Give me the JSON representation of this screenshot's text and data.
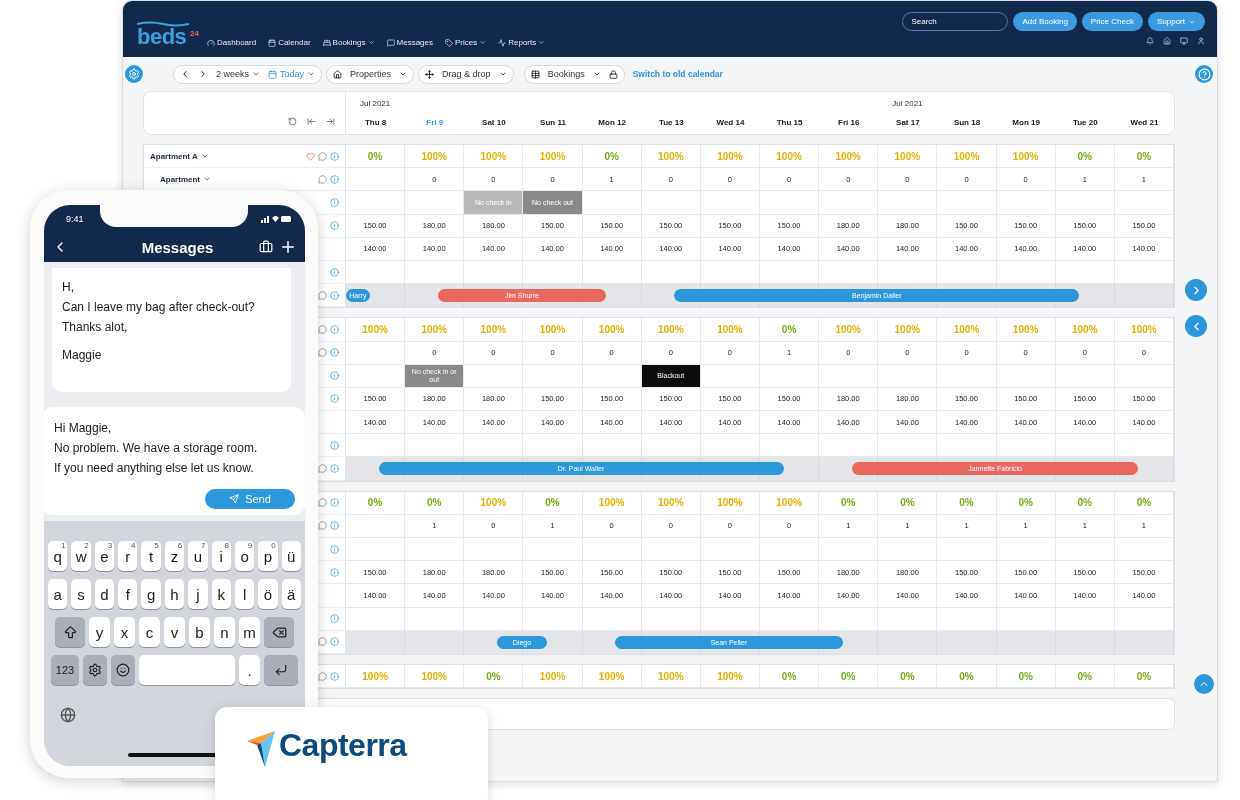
{
  "app": {
    "logo": {
      "text": "beds",
      "badge": "24"
    },
    "nav": [
      {
        "label": "Dashboard",
        "dropdown": false
      },
      {
        "label": "Calendar",
        "dropdown": false
      },
      {
        "label": "Bookings",
        "dropdown": true
      },
      {
        "label": "Messages",
        "dropdown": false
      },
      {
        "label": "Prices",
        "dropdown": true
      },
      {
        "label": "Reports",
        "dropdown": true
      }
    ],
    "search": {
      "placeholder": "Search"
    },
    "buttons": [
      {
        "label": "Add Booking",
        "dropdown": false
      },
      {
        "label": "Price Check",
        "dropdown": false
      },
      {
        "label": "Support",
        "dropdown": true
      }
    ]
  },
  "toolbar": {
    "range": "2 weeks",
    "today": "Today",
    "properties": "Properties",
    "drag": "Drag & drop",
    "view": "Bookings",
    "link": "Switch to old calendar"
  },
  "calendar": {
    "days": [
      {
        "label": "Thu 8",
        "month": "Jul 2021",
        "today": false
      },
      {
        "label": "Fri 9",
        "today": true
      },
      {
        "label": "Sat 10",
        "today": false
      },
      {
        "label": "Sun 11",
        "today": false
      },
      {
        "label": "Mon 12",
        "today": false
      },
      {
        "label": "Tue 13",
        "today": false
      },
      {
        "label": "Wed 14",
        "today": false
      },
      {
        "label": "Thu 15",
        "today": false
      },
      {
        "label": "Fri 16",
        "today": false
      },
      {
        "label": "Sat 17",
        "month": "Jul 2021",
        "today": false
      },
      {
        "label": "Sun 18",
        "today": false
      },
      {
        "label": "Mon 19",
        "today": false
      },
      {
        "label": "Tue 20",
        "today": false
      },
      {
        "label": "Wed 21",
        "today": false
      }
    ],
    "groups": [
      {
        "name": "Apartment A",
        "unit": "Apartment",
        "occupancy": [
          {
            "text": "0%",
            "color": "#76ad17"
          },
          {
            "text": "100%",
            "color": "#e5b000"
          },
          {
            "text": "100%",
            "color": "#e5b000"
          },
          {
            "text": "100%",
            "color": "#e5b000"
          },
          {
            "text": "0%",
            "color": "#76ad17"
          },
          {
            "text": "100%",
            "color": "#e5b000"
          },
          {
            "text": "100%",
            "color": "#e5b000"
          },
          {
            "text": "100%",
            "color": "#e5b000"
          },
          {
            "text": "100%",
            "color": "#e5b000"
          },
          {
            "text": "100%",
            "color": "#e5b000"
          },
          {
            "text": "100%",
            "color": "#e5b000"
          },
          {
            "text": "100%",
            "color": "#e5b000"
          },
          {
            "text": "0%",
            "color": "#76ad17"
          },
          {
            "text": "0%",
            "color": "#76ad17"
          }
        ],
        "counts": [
          {
            "kind": "none"
          },
          {
            "kind": "value",
            "text": "0"
          },
          {
            "kind": "value",
            "text": "0"
          },
          {
            "kind": "value",
            "text": "0"
          },
          {
            "kind": "value",
            "text": "1"
          },
          {
            "kind": "value",
            "text": "0"
          },
          {
            "kind": "value",
            "text": "0"
          },
          {
            "kind": "value",
            "text": "0"
          },
          {
            "kind": "value",
            "text": "0"
          },
          {
            "kind": "value",
            "text": "0"
          },
          {
            "kind": "value",
            "text": "0"
          },
          {
            "kind": "value",
            "text": "0"
          },
          {
            "kind": "value",
            "text": "1"
          },
          {
            "kind": "value",
            "text": "1"
          }
        ],
        "restrictions": [
          {
            "kind": "none"
          },
          {
            "kind": "none"
          },
          {
            "text": "No check in",
            "kind": "light"
          },
          {
            "text": "No check out",
            "kind": "dark"
          },
          {
            "kind": "none"
          },
          {
            "kind": "none"
          },
          {
            "kind": "none"
          },
          {
            "kind": "none"
          },
          {
            "kind": "none"
          },
          {
            "kind": "none"
          },
          {
            "kind": "none"
          },
          {
            "kind": "none"
          },
          {
            "kind": "none"
          },
          {
            "kind": "none"
          }
        ],
        "prices": [
          "150.00",
          "180.00",
          "180.00",
          "150.00",
          "150.00",
          "150.00",
          "150.00",
          "150.00",
          "180.00",
          "180.00",
          "150.00",
          "150.00",
          "150.00",
          "150.00"
        ],
        "rates": [
          "140.00",
          "140.00",
          "140.00",
          "140.00",
          "140.00",
          "140.00",
          "140.00",
          "140.00",
          "140.00",
          "140.00",
          "140.00",
          "140.00",
          "140.00",
          "140.00"
        ],
        "bookings": [
          {
            "kind": "close",
            "guest": "Harry",
            "color": "#2d97dc"
          },
          {
            "kind": "open",
            "guest": "Jim Shurre",
            "color": "#e8685f"
          },
          {
            "kind": "through"
          },
          {
            "kind": "through"
          },
          {
            "kind": "close"
          },
          {
            "kind": "open",
            "guest": "Benjamin Daller",
            "color": "#2d97dc"
          },
          {
            "kind": "through"
          },
          {
            "kind": "through"
          },
          {
            "kind": "through"
          },
          {
            "kind": "through"
          },
          {
            "kind": "through"
          },
          {
            "kind": "through"
          },
          {
            "kind": "close"
          },
          {
            "kind": "free"
          }
        ]
      },
      {
        "occupancy": [
          {
            "text": "100%",
            "color": "#e5b000"
          },
          {
            "text": "100%",
            "color": "#e5b000"
          },
          {
            "text": "100%",
            "color": "#e5b000"
          },
          {
            "text": "100%",
            "color": "#e5b000"
          },
          {
            "text": "100%",
            "color": "#e5b000"
          },
          {
            "text": "100%",
            "color": "#e5b000"
          },
          {
            "text": "100%",
            "color": "#e5b000"
          },
          {
            "text": "0%",
            "color": "#76ad17"
          },
          {
            "text": "100%",
            "color": "#e5b000"
          },
          {
            "text": "100%",
            "color": "#e5b000"
          },
          {
            "text": "100%",
            "color": "#e5b000"
          },
          {
            "text": "100%",
            "color": "#e5b000"
          },
          {
            "text": "100%",
            "color": "#e5b000"
          },
          {
            "text": "100%",
            "color": "#e5b000"
          }
        ],
        "counts": [
          {
            "kind": "none"
          },
          {
            "kind": "value",
            "text": "0"
          },
          {
            "kind": "value",
            "text": "0"
          },
          {
            "kind": "value",
            "text": "0"
          },
          {
            "kind": "value",
            "text": "0"
          },
          {
            "kind": "value",
            "text": "0"
          },
          {
            "kind": "value",
            "text": "0"
          },
          {
            "kind": "value",
            "text": "1"
          },
          {
            "kind": "value",
            "text": "0"
          },
          {
            "kind": "value",
            "text": "0"
          },
          {
            "kind": "value",
            "text": "0"
          },
          {
            "kind": "value",
            "text": "0"
          },
          {
            "kind": "value",
            "text": "0"
          },
          {
            "kind": "value",
            "text": "0"
          }
        ],
        "restrictions": [
          {
            "kind": "none"
          },
          {
            "text": "No check in or out",
            "kind": "dark"
          },
          {
            "kind": "none"
          },
          {
            "kind": "none"
          },
          {
            "kind": "none"
          },
          {
            "text": "Blackout",
            "kind": "black"
          },
          {
            "kind": "none"
          },
          {
            "kind": "none"
          },
          {
            "kind": "none"
          },
          {
            "kind": "none"
          },
          {
            "kind": "none"
          },
          {
            "kind": "none"
          },
          {
            "kind": "none"
          },
          {
            "kind": "none"
          }
        ],
        "prices": [
          "150.00",
          "180.00",
          "180.00",
          "150.00",
          "150.00",
          "150.00",
          "150.00",
          "150.00",
          "180.00",
          "180.00",
          "150.00",
          "150.00",
          "150.00",
          "150.00"
        ],
        "rates": [
          "140.00",
          "140.00",
          "140.00",
          "140.00",
          "140.00",
          "140.00",
          "140.00",
          "140.00",
          "140.00",
          "140.00",
          "140.00",
          "140.00",
          "140.00",
          "140.00"
        ],
        "bookings": [
          {
            "kind": "open",
            "guest": "Dr. Paul Waller",
            "color": "#2d97dc"
          },
          {
            "kind": "through"
          },
          {
            "kind": "through"
          },
          {
            "kind": "through"
          },
          {
            "kind": "through"
          },
          {
            "kind": "through"
          },
          {
            "kind": "through"
          },
          {
            "kind": "close"
          },
          {
            "kind": "open",
            "guest": "Jannette Fabricio",
            "color": "#e8685f"
          },
          {
            "kind": "through"
          },
          {
            "kind": "through"
          },
          {
            "kind": "through"
          },
          {
            "kind": "through"
          },
          {
            "kind": "close"
          }
        ]
      },
      {
        "occupancy": [
          {
            "text": "0%",
            "color": "#76ad17"
          },
          {
            "text": "0%",
            "color": "#76ad17"
          },
          {
            "text": "100%",
            "color": "#e5b000"
          },
          {
            "text": "0%",
            "color": "#76ad17"
          },
          {
            "text": "100%",
            "color": "#e5b000"
          },
          {
            "text": "100%",
            "color": "#e5b000"
          },
          {
            "text": "100%",
            "color": "#e5b000"
          },
          {
            "text": "100%",
            "color": "#e5b000"
          },
          {
            "text": "0%",
            "color": "#76ad17"
          },
          {
            "text": "0%",
            "color": "#76ad17"
          },
          {
            "text": "0%",
            "color": "#76ad17"
          },
          {
            "text": "0%",
            "color": "#76ad17"
          },
          {
            "text": "0%",
            "color": "#76ad17"
          },
          {
            "text": "0%",
            "color": "#76ad17"
          }
        ],
        "counts": [
          {
            "kind": "none"
          },
          {
            "kind": "value",
            "text": "1"
          },
          {
            "kind": "value",
            "text": "0"
          },
          {
            "kind": "value",
            "text": "1"
          },
          {
            "kind": "value",
            "text": "0"
          },
          {
            "kind": "value",
            "text": "0"
          },
          {
            "kind": "value",
            "text": "0"
          },
          {
            "kind": "value",
            "text": "0"
          },
          {
            "kind": "value",
            "text": "1"
          },
          {
            "kind": "value",
            "text": "1"
          },
          {
            "kind": "value",
            "text": "1"
          },
          {
            "kind": "value",
            "text": "1"
          },
          {
            "kind": "value",
            "text": "1"
          },
          {
            "kind": "value",
            "text": "1"
          }
        ],
        "prices": [
          "150.00",
          "180.00",
          "180.00",
          "150.00",
          "150.00",
          "150.00",
          "150.00",
          "150.00",
          "180.00",
          "180.00",
          "150.00",
          "150.00",
          "150.00",
          "150.00"
        ],
        "rates": [
          "140.00",
          "140.00",
          "140.00",
          "140.00",
          "140.00",
          "140.00",
          "140.00",
          "140.00",
          "140.00",
          "140.00",
          "140.00",
          "140.00",
          "140.00",
          "140.00"
        ],
        "bookings": [
          {
            "kind": "free"
          },
          {
            "kind": "free"
          },
          {
            "kind": "open",
            "guest": "Diego",
            "color": "#2d97dc"
          },
          {
            "kind": "close"
          },
          {
            "kind": "open",
            "guest": "Sean Pelter",
            "color": "#2d97dc"
          },
          {
            "kind": "through"
          },
          {
            "kind": "through"
          },
          {
            "kind": "through"
          },
          {
            "kind": "close"
          },
          {
            "kind": "free"
          },
          {
            "kind": "free"
          },
          {
            "kind": "free"
          },
          {
            "kind": "free"
          },
          {
            "kind": "free"
          }
        ]
      },
      {
        "occupancy": [
          {
            "text": "100%",
            "color": "#e5b000"
          },
          {
            "text": "100%",
            "color": "#e5b000"
          },
          {
            "text": "0%",
            "color": "#76ad17"
          },
          {
            "text": "100%",
            "color": "#e5b000"
          },
          {
            "text": "100%",
            "color": "#e5b000"
          },
          {
            "text": "100%",
            "color": "#e5b000"
          },
          {
            "text": "100%",
            "color": "#e5b000"
          },
          {
            "text": "0%",
            "color": "#76ad17"
          },
          {
            "text": "0%",
            "color": "#76ad17"
          },
          {
            "text": "0%",
            "color": "#76ad17"
          },
          {
            "text": "0%",
            "color": "#76ad17"
          },
          {
            "text": "0%",
            "color": "#76ad17"
          },
          {
            "text": "0%",
            "color": "#76ad17"
          },
          {
            "text": "0%",
            "color": "#76ad17"
          }
        ]
      }
    ]
  },
  "phone": {
    "time": "9:41",
    "title": "Messages",
    "incoming": {
      "lines": [
        "H,",
        "Can I leave my bag after check-out?",
        "Thanks alot,"
      ],
      "signature": "Maggie"
    },
    "reply": {
      "lines": [
        "Hi Maggie,",
        "No problem. We have a storage room.",
        "If you need anything else let us know."
      ],
      "send": "Send"
    },
    "keyboard": [
      [
        {
          "kind": "letter",
          "label": "q",
          "hint": "1"
        },
        {
          "kind": "letter",
          "label": "w",
          "hint": "2"
        },
        {
          "kind": "letter",
          "label": "e",
          "hint": "3"
        },
        {
          "kind": "letter",
          "label": "r",
          "hint": "4"
        },
        {
          "kind": "letter",
          "label": "t",
          "hint": "5"
        },
        {
          "kind": "letter",
          "label": "z",
          "hint": "6"
        },
        {
          "kind": "letter",
          "label": "u",
          "hint": "7"
        },
        {
          "kind": "letter",
          "label": "i",
          "hint": "8"
        },
        {
          "kind": "letter",
          "label": "o",
          "hint": "9"
        },
        {
          "kind": "letter",
          "label": "p",
          "hint": "0"
        },
        {
          "kind": "letter",
          "label": "ü"
        }
      ],
      [
        {
          "kind": "letter",
          "label": "a"
        },
        {
          "kind": "letter",
          "label": "s"
        },
        {
          "kind": "letter",
          "label": "d"
        },
        {
          "kind": "letter",
          "label": "f"
        },
        {
          "kind": "letter",
          "label": "g"
        },
        {
          "kind": "letter",
          "label": "h"
        },
        {
          "kind": "letter",
          "label": "j"
        },
        {
          "kind": "letter",
          "label": "k"
        },
        {
          "kind": "letter",
          "label": "l"
        },
        {
          "kind": "letter",
          "label": "ö"
        },
        {
          "kind": "letter",
          "label": "ä"
        }
      ],
      [
        {
          "kind": "shift"
        },
        {
          "kind": "letter",
          "label": "y"
        },
        {
          "kind": "letter",
          "label": "x"
        },
        {
          "kind": "letter",
          "label": "c"
        },
        {
          "kind": "letter",
          "label": "v"
        },
        {
          "kind": "letter",
          "label": "b"
        },
        {
          "kind": "letter",
          "label": "n"
        },
        {
          "kind": "letter",
          "label": "m"
        },
        {
          "kind": "backspace"
        }
      ],
      [
        {
          "kind": "mode",
          "label": "123"
        },
        {
          "kind": "settings"
        },
        {
          "kind": "emoji"
        },
        {
          "kind": "space"
        },
        {
          "kind": "letter",
          "label": "."
        },
        {
          "kind": "return"
        }
      ]
    ]
  },
  "badge": {
    "text": "Capterra"
  }
}
